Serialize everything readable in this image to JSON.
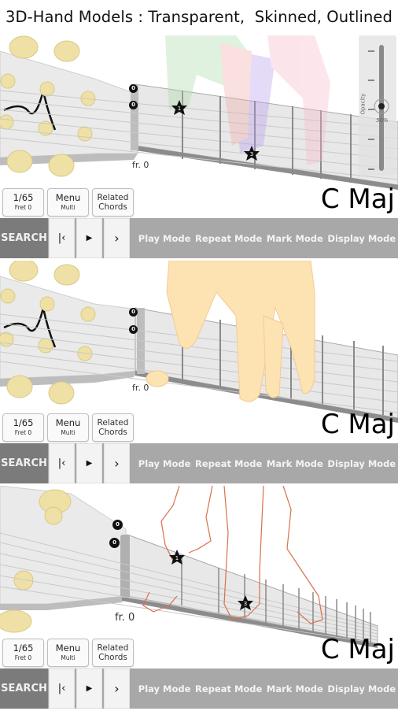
{
  "header": {
    "title": "3D-Hand Models : Transparent,  Skinned, Outlined"
  },
  "panels": [
    {
      "model": "Transparent",
      "fret_label": "fr. 0",
      "open_strings": [
        "0",
        "0"
      ],
      "finger_markers": [
        "1",
        "3"
      ],
      "opacity_slider": {
        "label": "Opacity",
        "value_text": "50%",
        "value": 0.5
      },
      "buttons": {
        "position": "1/65",
        "fret": "Fret 0",
        "menu": "Menu",
        "menu_sub": "Multi",
        "related_1": "Related",
        "related_2": "Chords"
      },
      "chord_name": "C Maj",
      "toolbar": {
        "search": "SEARCH",
        "first": "K",
        "play": "▶",
        "next": "›",
        "modes": [
          "Play Mode",
          "Repeat Mode",
          "Mark Mode",
          "Display Mode"
        ]
      }
    },
    {
      "model": "Skinned",
      "fret_label": "fr. 0",
      "open_strings": [
        "0",
        "0"
      ],
      "finger_markers": [],
      "buttons": {
        "position": "1/65",
        "fret": "Fret 0",
        "menu": "Menu",
        "menu_sub": "Multi",
        "related_1": "Related",
        "related_2": "Chords"
      },
      "chord_name": "C Maj",
      "toolbar": {
        "search": "SEARCH",
        "first": "K",
        "play": "▶",
        "next": "›",
        "modes": [
          "Play Mode",
          "Repeat Mode",
          "Mark Mode",
          "Display Mode"
        ]
      }
    },
    {
      "model": "Outlined",
      "fret_label": "fr. 0",
      "open_strings": [
        "0",
        "0"
      ],
      "finger_markers": [
        "1",
        "3"
      ],
      "buttons": {
        "position": "1/65",
        "fret": "Fret 0",
        "menu": "Menu",
        "menu_sub": "Multi",
        "related_1": "Related",
        "related_2": "Chords"
      },
      "chord_name": "C Maj",
      "toolbar": {
        "search": "SEARCH",
        "first": "K",
        "play": "▶",
        "next": "›",
        "modes": [
          "Play Mode",
          "Repeat Mode",
          "Mark Mode",
          "Display Mode"
        ]
      }
    }
  ],
  "colors": {
    "toolbar_bg": "#a8a8a8",
    "search_bg": "#7b7b7b",
    "peg": "#efe1a6",
    "fretboard": "#e6e6e6",
    "outline_hand": "#d9704a",
    "skin_hand": "#fde2b0"
  }
}
